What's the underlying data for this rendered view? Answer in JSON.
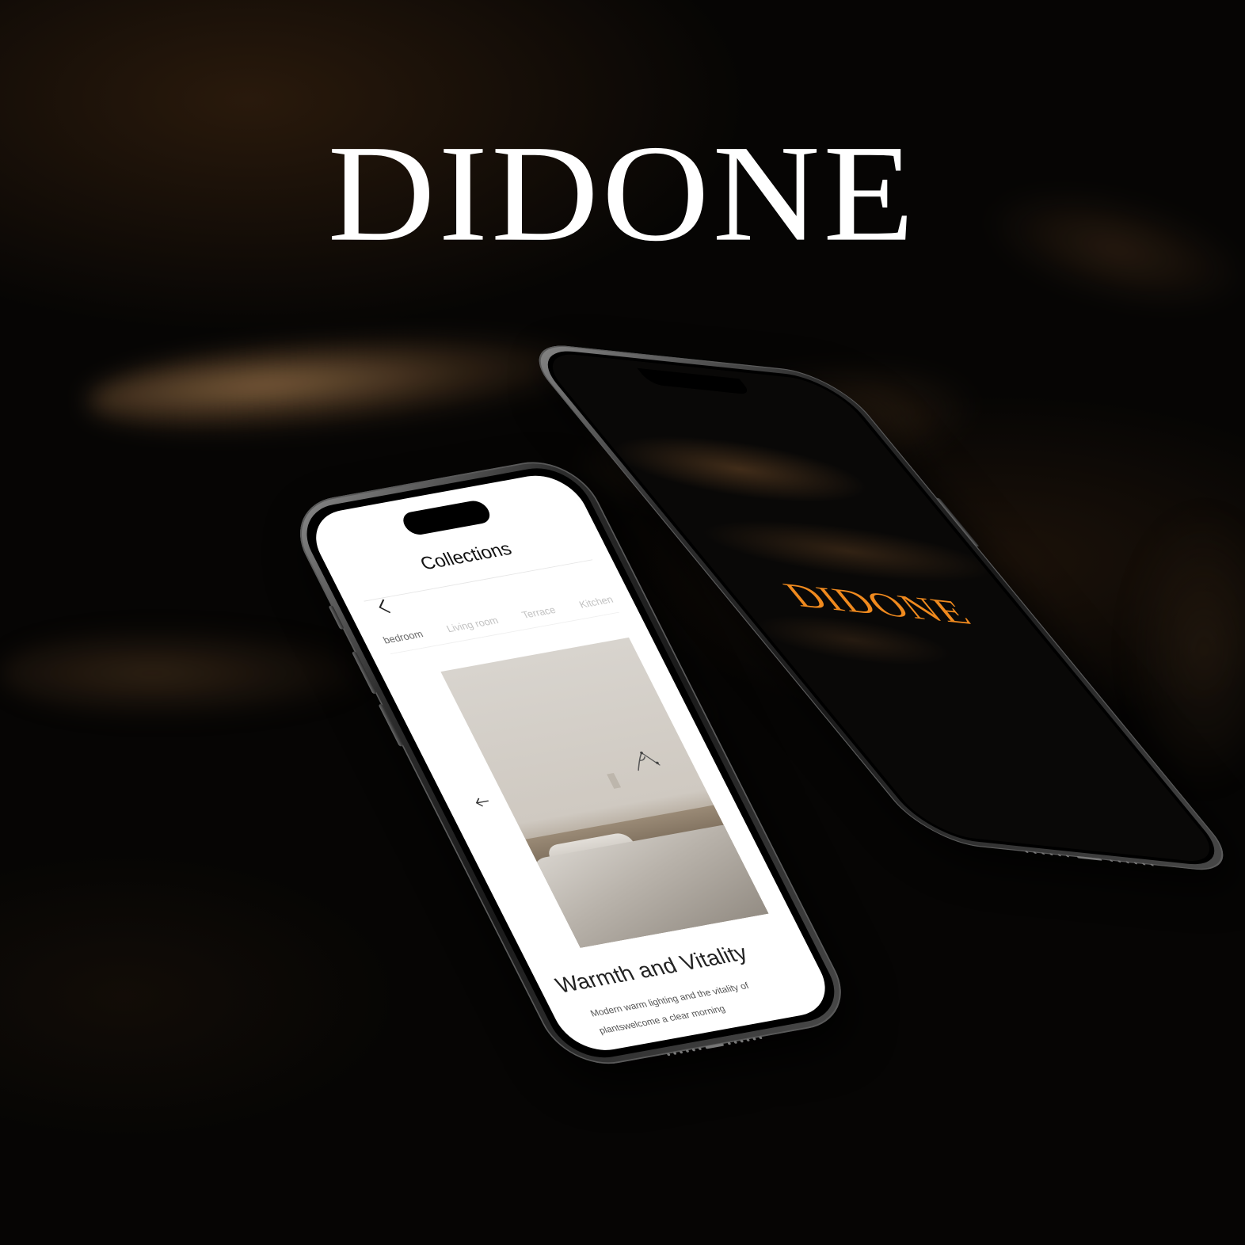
{
  "brand": {
    "title": "DIDONE"
  },
  "colors": {
    "accent": "#f08a1e",
    "background": "#060504",
    "screen_light": "#ffffff"
  },
  "light_phone": {
    "header": {
      "title": "Collections",
      "back_icon": "chevron-left-icon"
    },
    "tabs": [
      {
        "label": "bedroom",
        "active": true
      },
      {
        "label": "Living room",
        "active": false
      },
      {
        "label": "Terrace",
        "active": false
      },
      {
        "label": "Kitchen",
        "active": false
      }
    ],
    "carousel": {
      "prev_icon": "arrow-left-icon"
    },
    "card": {
      "title": "Warmth and Vitality",
      "description_line1": "Modern warm lighting and the vitality of",
      "description_line2": "plantswelcome a clear morning"
    }
  },
  "dark_phone": {
    "logo": "DIDONE"
  }
}
